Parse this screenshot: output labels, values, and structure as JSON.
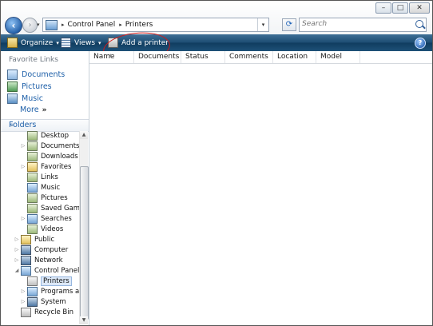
{
  "window": {
    "buttons": [
      "–",
      "□",
      "✕"
    ]
  },
  "address_bar": {
    "segments": [
      "Control Panel",
      "Printers"
    ],
    "separator": "▸"
  },
  "search": {
    "placeholder": "Search"
  },
  "command_bar": {
    "organize_label": "Organize",
    "views_label": "Views",
    "add_printer_label": "Add a printer",
    "dropdown_arrow": "▾",
    "help_glyph": "?"
  },
  "favorite_links": {
    "header": "Favorite Links",
    "items": [
      "Documents",
      "Pictures",
      "Music"
    ],
    "more_label": "More",
    "more_glyph": "»"
  },
  "folders": {
    "header": "Folders",
    "chevron": "⌄",
    "tree": [
      {
        "label": "Desktop"
      },
      {
        "label": "Documents"
      },
      {
        "label": "Downloads"
      },
      {
        "label": "Favorites"
      },
      {
        "label": "Links"
      },
      {
        "label": "Music"
      },
      {
        "label": "Pictures"
      },
      {
        "label": "Saved Games"
      },
      {
        "label": "Searches"
      },
      {
        "label": "Videos"
      },
      {
        "label": "Public"
      },
      {
        "label": "Computer"
      },
      {
        "label": "Network"
      },
      {
        "label": "Control Panel"
      },
      {
        "label": "Printers",
        "selected": true
      },
      {
        "label": "Programs and"
      },
      {
        "label": "System"
      },
      {
        "label": "Recycle Bin"
      }
    ]
  },
  "columns": [
    "Name",
    "Documents",
    "Status",
    "Comments",
    "Location",
    "Model"
  ],
  "colors": {
    "command_bar": "#1c4c72",
    "link_blue": "#1d5fa8",
    "annotation_red": "#d01a1a"
  }
}
